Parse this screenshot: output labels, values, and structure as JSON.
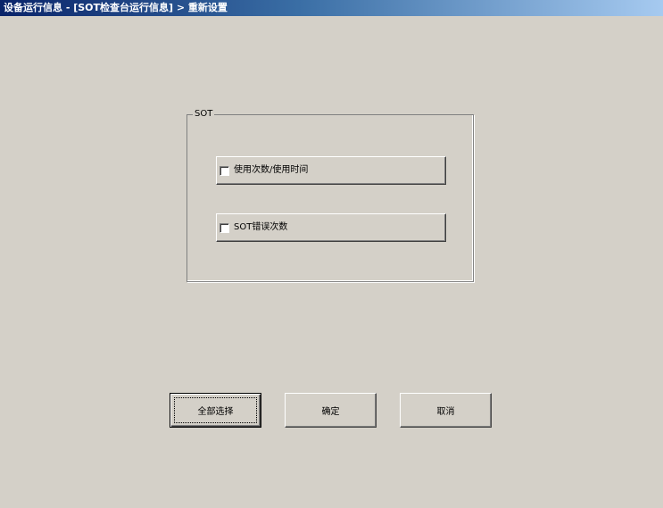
{
  "window": {
    "title": "设备运行信息 - [SOT检查台运行信息] > 重新设置"
  },
  "group": {
    "label": "SOT",
    "options": [
      {
        "label": "使用次数/使用时间",
        "checked": false
      },
      {
        "label": "SOT错误次数",
        "checked": false
      }
    ]
  },
  "buttons": {
    "select_all": "全部选择",
    "ok": "确定",
    "cancel": "取消"
  },
  "colors": {
    "face": "#d4d0c8",
    "title_start": "#0a246a",
    "title_end": "#a6caf0"
  }
}
